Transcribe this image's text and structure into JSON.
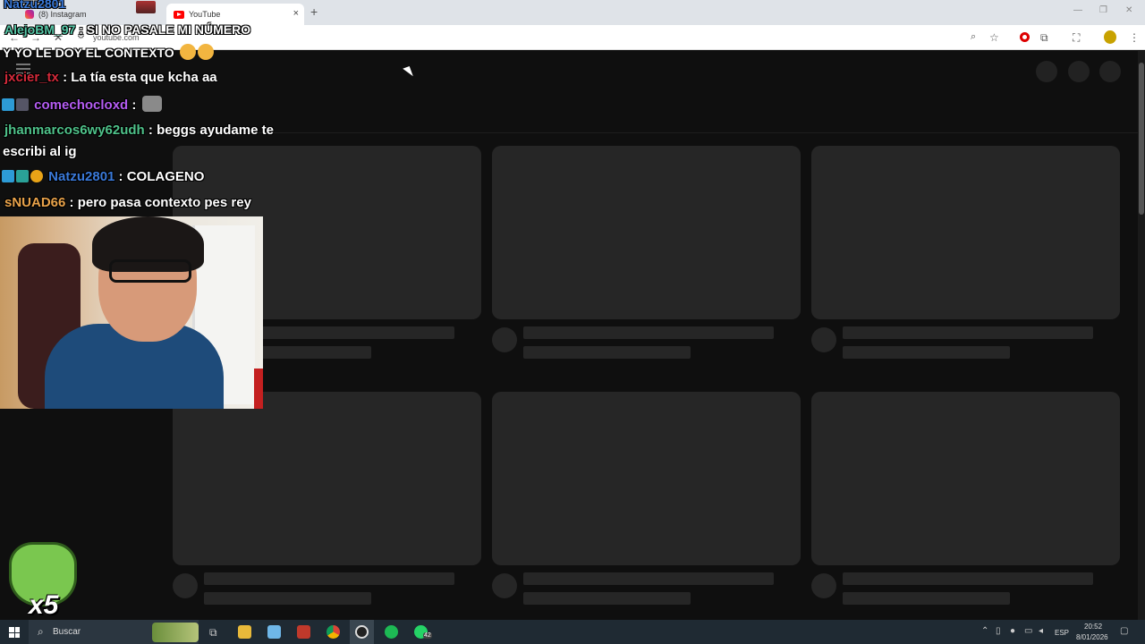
{
  "browser": {
    "tabs": [
      {
        "label": "(8) Instagram",
        "active": false
      },
      {
        "label": "YouTube",
        "active": true
      }
    ],
    "url": "youtube.com",
    "new_tab": "+",
    "close_glyph": "×",
    "window_controls": {
      "minimize": "—",
      "maximize": "❐",
      "close": "✕"
    },
    "toolbar_icons": [
      "zoom-icon",
      "star-icon",
      "opera-icon",
      "extensions-icon",
      "screenshot-icon",
      "profile-icon",
      "menu-icon"
    ]
  },
  "chat": {
    "messages": [
      {
        "user": "AlejoBM_97",
        "text": ": SI NO PASALE MI NÚMERO",
        "color": "#57c8a8"
      },
      {
        "user": "",
        "text": "Y YO LE DOY EL CONTEXTO",
        "color": "#ffffff"
      },
      {
        "user": "jxcier_tx",
        "text": ": La tía esta que kcha aa",
        "color": "#d22a3a"
      },
      {
        "user": "comechocloxd",
        "text": ":",
        "color": "#b45cf2"
      },
      {
        "user": "jhanmarcos6wy62udh",
        "text": ": beggs ayudame te",
        "color": "#4fc28a"
      },
      {
        "user": "",
        "text": "escribi al ig",
        "color": "#ffffff"
      },
      {
        "user": "Natzu2801",
        "text": ": COLAGENO",
        "color": "#3a79d8"
      },
      {
        "user": "sNUAD66",
        "text": ": pero pasa contexto pes rey",
        "color": "#e8a24a"
      }
    ]
  },
  "tab_top_overlay": "Natzu2801",
  "emote_multiplier": "x5",
  "taskbar": {
    "search_label": "Buscar",
    "apps": [
      "task-view-icon",
      "file-explorer-icon",
      "notes-icon",
      "app-icon",
      "chrome-icon",
      "obs-icon",
      "spotify-icon",
      "whatsapp-icon"
    ],
    "whatsapp_badge": "42",
    "language": "ESP",
    "time": "20:52",
    "date": "8/01/2026"
  },
  "colors": {
    "yt_background": "#0f0f0f",
    "skeleton": "#262626",
    "taskbar": "#1f2a33"
  }
}
